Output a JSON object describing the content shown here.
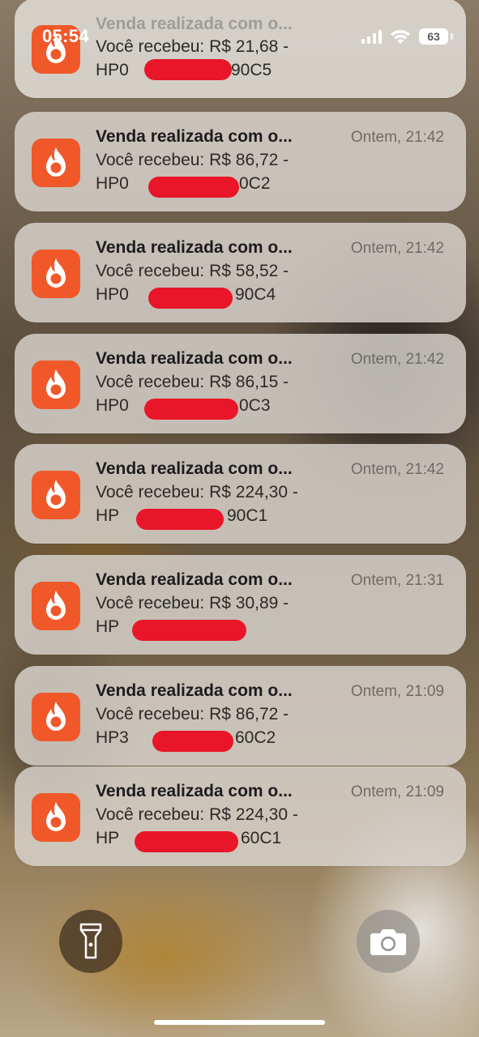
{
  "status_bar": {
    "time": "05:54",
    "battery": "63"
  },
  "notifications": [
    {
      "title": "Venda realizada com o...",
      "time": "",
      "line1": "Você recebeu: R$ 21,68 -",
      "line2_prefix": "HP0",
      "line2_suffix": "90C5"
    },
    {
      "title": "Venda realizada com o...",
      "time": "Ontem, 21:42",
      "line1": "Você recebeu: R$ 86,72 -",
      "line2_prefix": "HP0",
      "line2_suffix": "0C2"
    },
    {
      "title": "Venda realizada com o...",
      "time": "Ontem, 21:42",
      "line1": "Você recebeu: R$ 58,52 -",
      "line2_prefix": "HP0",
      "line2_suffix": "90C4"
    },
    {
      "title": "Venda realizada com o...",
      "time": "Ontem, 21:42",
      "line1": "Você recebeu: R$ 86,15 -",
      "line2_prefix": "HP0",
      "line2_suffix": "0C3"
    },
    {
      "title": "Venda realizada com o...",
      "time": "Ontem, 21:42",
      "line1": "Você recebeu: R$ 224,30 -",
      "line2_prefix": "HP",
      "line2_suffix": "90C1"
    },
    {
      "title": "Venda realizada com o...",
      "time": "Ontem, 21:31",
      "line1": "Você recebeu: R$ 30,89 -",
      "line2_prefix": "HP",
      "line2_suffix": ""
    },
    {
      "title": "Venda realizada com o...",
      "time": "Ontem, 21:09",
      "line1": "Você recebeu: R$ 86,72 -",
      "line2_prefix": "HP3",
      "line2_suffix": "60C2"
    },
    {
      "title": "Venda realizada com o...",
      "time": "Ontem, 21:09",
      "line1": "Você recebeu: R$ 224,30 -",
      "line2_prefix": "HP",
      "line2_suffix": "60C1"
    }
  ],
  "quick_actions": {
    "left_icon": "flashlight-icon",
    "right_icon": "camera-icon"
  },
  "colors": {
    "app_icon": "#f0582a",
    "redaction": "#e81628"
  }
}
